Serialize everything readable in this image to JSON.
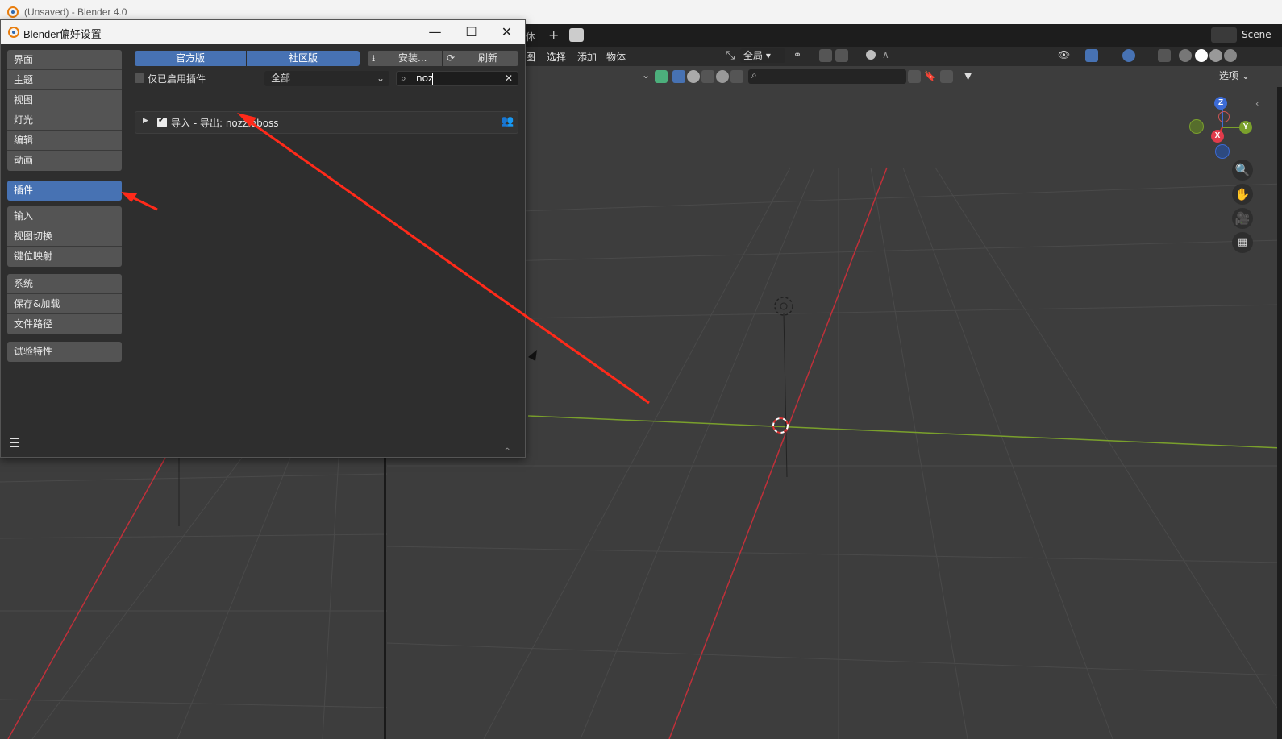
{
  "main_window": {
    "title": "(Unsaved) - Blender 4.0"
  },
  "workspace_bar": {
    "tab_partial": "体",
    "add_tab": "+",
    "scene_label": "Scene"
  },
  "viewport_header": {
    "menu": [
      "图",
      "选择",
      "添加",
      "物体"
    ],
    "transform_orientation": "全局",
    "options_label": "选项"
  },
  "prefs": {
    "title": "Blender偏好设置",
    "controls": {
      "minimize": "—",
      "maximize": "☐",
      "close": "✕"
    },
    "nav_groups": [
      [
        "界面",
        "主题",
        "视图",
        "灯光",
        "编辑",
        "动画"
      ],
      [
        "插件"
      ],
      [
        "输入",
        "视图切换",
        "键位映射"
      ],
      [
        "系统",
        "保存&加载",
        "文件路径"
      ],
      [
        "试验特性"
      ]
    ],
    "active_nav": "插件",
    "tabs": {
      "official": "官方版",
      "community": "社区版"
    },
    "install_label": "安装...",
    "refresh_label": "刷新",
    "enabled_only_label": "仅已启用插件",
    "enabled_only_checked": false,
    "category_value": "全部",
    "search_value": "noz",
    "addon": {
      "name": "导入 - 导出: nozzleboss",
      "enabled": true
    },
    "menu_icon": "hamburger-menu-icon"
  },
  "gizmo": {
    "x": "X",
    "y": "Y",
    "z": "Z"
  },
  "colors": {
    "accent": "#4772b3",
    "annotation_arrow": "#ff2a1a",
    "x_axis": "#c0303a",
    "y_axis": "#7aa02c"
  }
}
